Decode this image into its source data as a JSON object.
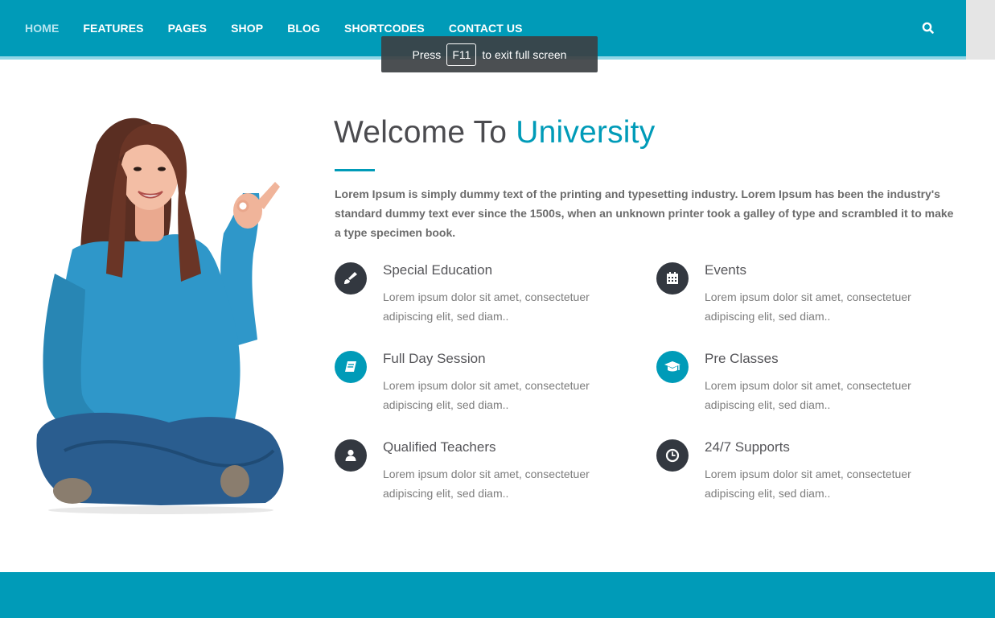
{
  "nav": {
    "items": [
      {
        "label": "HOME",
        "active": true
      },
      {
        "label": "FEATURES"
      },
      {
        "label": "PAGES"
      },
      {
        "label": "SHOP"
      },
      {
        "label": "BLOG"
      },
      {
        "label": "SHORTCODES"
      },
      {
        "label": "CONTACT US"
      }
    ],
    "search_icon": "search-icon"
  },
  "toast": {
    "before": "Press",
    "key": "F11",
    "after": "to exit full screen"
  },
  "welcome": {
    "title_main": "Welcome To",
    "title_accent": "University",
    "intro": "Lorem Ipsum is simply dummy text of the printing and typesetting industry. Lorem Ipsum has been the industry's standard dummy text ever since the 1500s, when an unknown printer took a galley of type and scrambled it to make a type specimen book."
  },
  "features": [
    {
      "title": "Special Education",
      "desc": "Lorem ipsum dolor sit amet, consectetuer adipiscing elit, sed diam..",
      "icon": "paintbrush-icon",
      "style": "dark"
    },
    {
      "title": "Events",
      "desc": "Lorem ipsum dolor sit amet, consectetuer adipiscing elit, sed diam..",
      "icon": "calendar-icon",
      "style": "dark"
    },
    {
      "title": "Full Day Session",
      "desc": "Lorem ipsum dolor sit amet, consectetuer adipiscing elit, sed diam..",
      "icon": "book-icon",
      "style": "teal"
    },
    {
      "title": "Pre Classes",
      "desc": "Lorem ipsum dolor sit amet, consectetuer adipiscing elit, sed diam..",
      "icon": "graduation-cap-icon",
      "style": "teal"
    },
    {
      "title": "Qualified Teachers",
      "desc": "Lorem ipsum dolor sit amet, consectetuer adipiscing elit, sed diam..",
      "icon": "user-icon",
      "style": "dark"
    },
    {
      "title": "24/7 Supports",
      "desc": "Lorem ipsum dolor sit amet, consectetuer adipiscing elit, sed diam..",
      "icon": "clock-icon",
      "style": "dark"
    }
  ],
  "colors": {
    "brand": "#009bb8",
    "dark_icon": "#333840",
    "heading": "#4b4b4f",
    "text": "#7d7d7d"
  }
}
